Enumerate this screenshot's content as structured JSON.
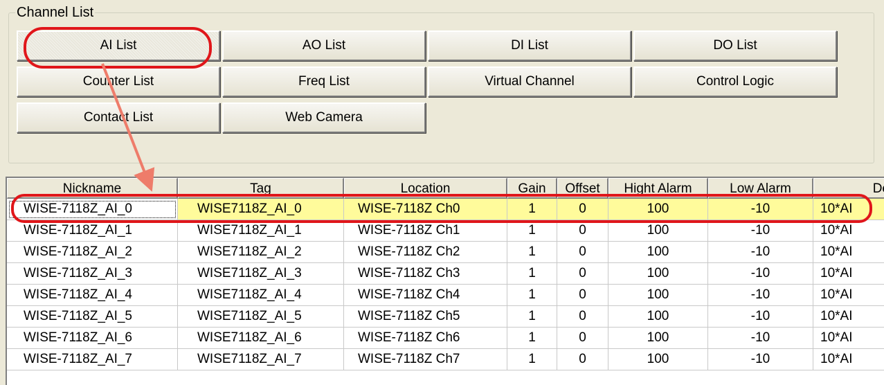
{
  "group_title": "Channel List",
  "buttons": {
    "ai_list": "AI List",
    "ao_list": "AO List",
    "di_list": "DI List",
    "do_list": "DO List",
    "counter_list": "Counter List",
    "freq_list": "Freq List",
    "virtual_channel": "Virtual Channel",
    "control_logic": "Control Logic",
    "contact_list": "Contact List",
    "web_camera": "Web Camera"
  },
  "table": {
    "headers": {
      "nickname": "Nickname",
      "tag": "Tag",
      "location": "Location",
      "gain": "Gain",
      "offset": "Offset",
      "high_alarm": "Hight Alarm",
      "low_alarm": "Low Alarm",
      "deadband": "De"
    },
    "rows": [
      {
        "nickname": "WISE-7118Z_AI_0",
        "tag": "WISE7118Z_AI_0",
        "location": "WISE-7118Z Ch0",
        "gain": "1",
        "offset": "0",
        "high_alarm": "100",
        "low_alarm": "-10",
        "deadband": "10*AI"
      },
      {
        "nickname": "WISE-7118Z_AI_1",
        "tag": "WISE7118Z_AI_1",
        "location": "WISE-7118Z Ch1",
        "gain": "1",
        "offset": "0",
        "high_alarm": "100",
        "low_alarm": "-10",
        "deadband": "10*AI"
      },
      {
        "nickname": "WISE-7118Z_AI_2",
        "tag": "WISE7118Z_AI_2",
        "location": "WISE-7118Z Ch2",
        "gain": "1",
        "offset": "0",
        "high_alarm": "100",
        "low_alarm": "-10",
        "deadband": "10*AI"
      },
      {
        "nickname": "WISE-7118Z_AI_3",
        "tag": "WISE7118Z_AI_3",
        "location": "WISE-7118Z Ch3",
        "gain": "1",
        "offset": "0",
        "high_alarm": "100",
        "low_alarm": "-10",
        "deadband": "10*AI"
      },
      {
        "nickname": "WISE-7118Z_AI_4",
        "tag": "WISE7118Z_AI_4",
        "location": "WISE-7118Z Ch4",
        "gain": "1",
        "offset": "0",
        "high_alarm": "100",
        "low_alarm": "-10",
        "deadband": "10*AI"
      },
      {
        "nickname": "WISE-7118Z_AI_5",
        "tag": "WISE7118Z_AI_5",
        "location": "WISE-7118Z Ch5",
        "gain": "1",
        "offset": "0",
        "high_alarm": "100",
        "low_alarm": "-10",
        "deadband": "10*AI"
      },
      {
        "nickname": "WISE-7118Z_AI_6",
        "tag": "WISE7118Z_AI_6",
        "location": "WISE-7118Z Ch6",
        "gain": "1",
        "offset": "0",
        "high_alarm": "100",
        "low_alarm": "-10",
        "deadband": "10*AI"
      },
      {
        "nickname": "WISE-7118Z_AI_7",
        "tag": "WISE7118Z_AI_7",
        "location": "WISE-7118Z Ch7",
        "gain": "1",
        "offset": "0",
        "high_alarm": "100",
        "low_alarm": "-10",
        "deadband": "10*AI"
      }
    ]
  },
  "colors": {
    "panel_bg": "#ece9d8",
    "selected_row": "#fffb9b",
    "annotation_red": "#e0161a",
    "arrow_salmon": "#ee7c6a"
  }
}
